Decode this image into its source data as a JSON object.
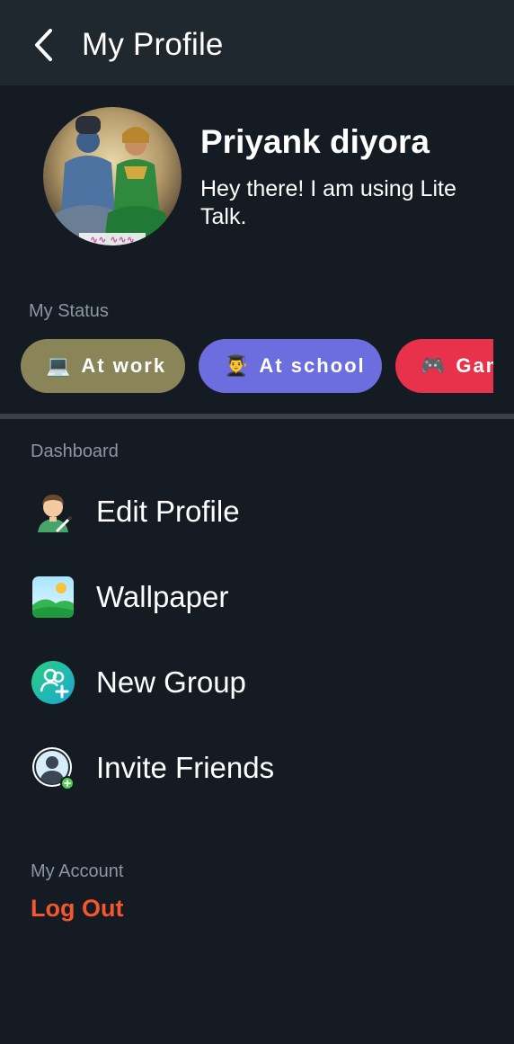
{
  "header": {
    "title": "My Profile",
    "back_icon": "chevron-left-icon"
  },
  "profile": {
    "name": "Priyank diyora",
    "about": "Hey there! I am using Lite Talk.",
    "avatar_icon": "profile-photo"
  },
  "status": {
    "label": "My Status",
    "chips": [
      {
        "emoji": "💻",
        "label": "At work",
        "color": "#8a8559"
      },
      {
        "emoji": "👨‍🎓",
        "label": "At school",
        "color": "#6c6ee0"
      },
      {
        "emoji": "🎮",
        "label": "Gaming",
        "color": "#e8314a"
      }
    ]
  },
  "dashboard": {
    "label": "Dashboard",
    "items": [
      {
        "label": "Edit Profile",
        "icon": "edit-profile-icon"
      },
      {
        "label": "Wallpaper",
        "icon": "wallpaper-icon"
      },
      {
        "label": "New Group",
        "icon": "new-group-icon"
      },
      {
        "label": "Invite Friends",
        "icon": "invite-friends-icon"
      }
    ]
  },
  "account": {
    "label": "My Account",
    "logout_label": "Log Out",
    "logout_color": "#f4572e"
  },
  "colors": {
    "background": "#151b23",
    "appbar": "#1f282f",
    "muted_text": "#8c96a0"
  }
}
